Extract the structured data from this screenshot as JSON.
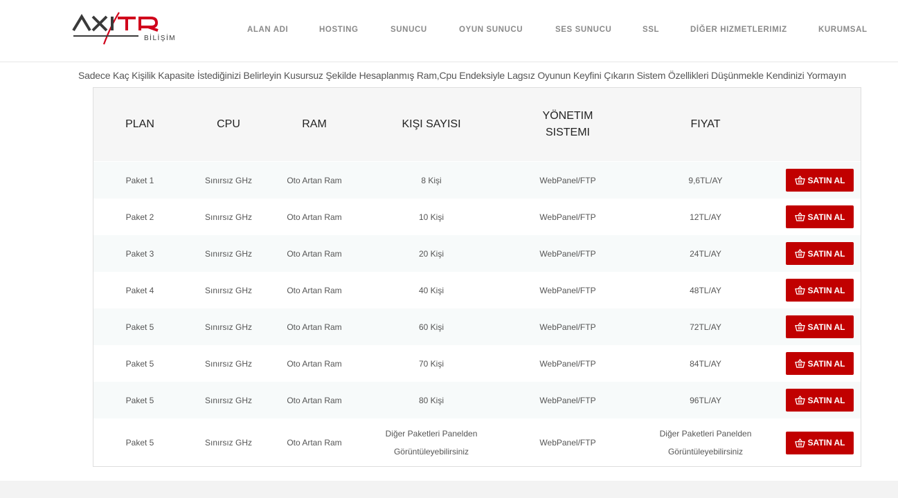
{
  "logo": {
    "name": "AXITR",
    "sub": "BİLİŞİM"
  },
  "nav": [
    {
      "label": "ALAN ADI"
    },
    {
      "label": "HOSTING"
    },
    {
      "label": "SUNUCU"
    },
    {
      "label": "OYUN SUNUCU"
    },
    {
      "label": "SES SUNUCU"
    },
    {
      "label": "SSL"
    },
    {
      "label": "DİĞER HIZMETLERIMIZ"
    },
    {
      "label": "KURUMSAL"
    }
  ],
  "tagline": "Sadece Kaç Kişilik Kapasite İstediğinizi Belirleyin Kusursuz Şekilde Hesaplanmış Ram,Cpu Endeksiyle Lagsız Oyunun Keyfini Çıkarın Sistem Özellikleri Düşünmekle Kendinizi Yormayın",
  "table": {
    "headers": {
      "plan": "PLAN",
      "cpu": "CPU",
      "ram": "RAM",
      "kisi": "KIŞI SAYISI",
      "yonetim": "YÖNETIM SISTEMI",
      "fiyat": "FIYAT"
    },
    "buy_label": "SATIN AL",
    "rows": [
      {
        "plan": "Paket 1",
        "cpu": "Sınırsız GHz",
        "ram": "Oto Artan Ram",
        "kisi": "8 Kişi",
        "yonetim": "WebPanel/FTP",
        "fiyat": "9,6TL/AY"
      },
      {
        "plan": "Paket 2",
        "cpu": "Sınırsız GHz",
        "ram": "Oto Artan Ram",
        "kisi": "10 Kişi",
        "yonetim": "WebPanel/FTP",
        "fiyat": "12TL/AY"
      },
      {
        "plan": "Paket 3",
        "cpu": "Sınırsız GHz",
        "ram": "Oto Artan Ram",
        "kisi": "20 Kişi",
        "yonetim": "WebPanel/FTP",
        "fiyat": "24TL/AY"
      },
      {
        "plan": "Paket 4",
        "cpu": "Sınırsız GHz",
        "ram": "Oto Artan Ram",
        "kisi": "40 Kişi",
        "yonetim": "WebPanel/FTP",
        "fiyat": "48TL/AY"
      },
      {
        "plan": "Paket 5",
        "cpu": "Sınırsız GHz",
        "ram": "Oto Artan Ram",
        "kisi": "60 Kişi",
        "yonetim": "WebPanel/FTP",
        "fiyat": "72TL/AY"
      },
      {
        "plan": "Paket 5",
        "cpu": "Sınırsız GHz",
        "ram": "Oto Artan Ram",
        "kisi": "70 Kişi",
        "yonetim": "WebPanel/FTP",
        "fiyat": "84TL/AY"
      },
      {
        "plan": "Paket 5",
        "cpu": "Sınırsız GHz",
        "ram": "Oto Artan Ram",
        "kisi": "80 Kişi",
        "yonetim": "WebPanel/FTP",
        "fiyat": "96TL/AY"
      },
      {
        "plan": "Paket 5",
        "cpu": "Sınırsız GHz",
        "ram": "Oto Artan Ram",
        "kisi": "Diğer Paketleri Panelden Görüntüleyebilirsiniz",
        "yonetim": "WebPanel/FTP",
        "fiyat": "Diğer Paketleri Panelden Görüntüleyebilirsiniz"
      }
    ]
  },
  "colors": {
    "accent": "#c10000",
    "nav_text": "#8a8a8a",
    "header_bg": "#f6f6f6",
    "alt_row_bg": "#f7fafa"
  },
  "icons": {
    "buy": "basket-icon"
  }
}
